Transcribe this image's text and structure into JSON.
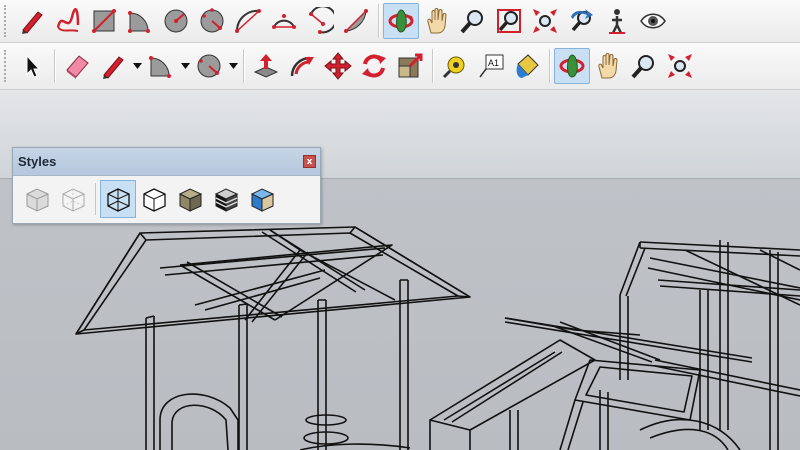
{
  "toolbar_row1": {
    "buttons": [
      {
        "name": "line-tool",
        "icon": "pencil-icon"
      },
      {
        "name": "freehand-tool",
        "icon": "freehand-curve-icon"
      },
      {
        "name": "rectangle-tool",
        "icon": "rectangle-icon"
      },
      {
        "name": "rotated-rectangle-tool",
        "icon": "rotated-rectangle-icon"
      },
      {
        "name": "circle-tool",
        "icon": "circle-icon"
      },
      {
        "name": "polygon-tool",
        "icon": "polygon-icon"
      },
      {
        "name": "arc-tool",
        "icon": "arc-icon"
      },
      {
        "name": "two-point-arc-tool",
        "icon": "two-point-arc-icon"
      },
      {
        "name": "three-point-arc-tool",
        "icon": "three-point-arc-icon"
      },
      {
        "name": "pie-tool",
        "icon": "pie-icon"
      },
      {
        "name": "orbit-tool",
        "icon": "orbit-icon",
        "active": true
      },
      {
        "name": "pan-tool",
        "icon": "hand-icon"
      },
      {
        "name": "zoom-tool",
        "icon": "magnifier-icon"
      },
      {
        "name": "zoom-window-tool",
        "icon": "zoom-window-icon"
      },
      {
        "name": "zoom-extents-tool",
        "icon": "zoom-extents-icon"
      },
      {
        "name": "previous-view-tool",
        "icon": "previous-view-icon"
      },
      {
        "name": "walk-tool",
        "icon": "walk-icon"
      },
      {
        "name": "look-around-tool",
        "icon": "eye-icon"
      }
    ]
  },
  "toolbar_row2": {
    "label_text_icon": "A1",
    "buttons": [
      {
        "name": "select-tool",
        "icon": "arrow-cursor-icon"
      },
      {
        "name": "eraser-tool",
        "icon": "eraser-icon"
      },
      {
        "name": "line-tool",
        "icon": "pencil-icon",
        "dropdown": true
      },
      {
        "name": "rectangle-tool",
        "icon": "rectangle-icon",
        "dropdown": true
      },
      {
        "name": "circle-tool",
        "icon": "circle-icon",
        "dropdown": true
      },
      {
        "name": "push-pull-tool",
        "icon": "push-pull-icon"
      },
      {
        "name": "follow-me-tool",
        "icon": "follow-me-icon"
      },
      {
        "name": "move-tool",
        "icon": "move-icon"
      },
      {
        "name": "rotate-tool",
        "icon": "rotate-icon"
      },
      {
        "name": "scale-tool",
        "icon": "scale-icon"
      },
      {
        "name": "tape-measure-tool",
        "icon": "tape-measure-icon"
      },
      {
        "name": "text-tool",
        "icon": "text-label-icon"
      },
      {
        "name": "paint-bucket-tool",
        "icon": "paint-bucket-icon"
      },
      {
        "name": "orbit-tool",
        "icon": "orbit-icon",
        "active": true
      },
      {
        "name": "pan-tool",
        "icon": "hand-icon"
      },
      {
        "name": "zoom-tool",
        "icon": "magnifier-icon"
      },
      {
        "name": "zoom-extents-tool",
        "icon": "zoom-extents-icon"
      }
    ]
  },
  "styles_panel": {
    "title": "Styles",
    "close_label": "x",
    "styles": [
      {
        "name": "xray-style",
        "icon": "xray-cube-icon"
      },
      {
        "name": "back-edges-style",
        "icon": "back-edges-cube-icon"
      },
      {
        "name": "wireframe-style",
        "icon": "wireframe-cube-icon",
        "active": true
      },
      {
        "name": "hidden-line-style",
        "icon": "hidden-line-cube-icon"
      },
      {
        "name": "shaded-style",
        "icon": "shaded-cube-icon"
      },
      {
        "name": "shaded-with-textures-style",
        "icon": "textured-cube-icon"
      },
      {
        "name": "monochrome-style",
        "icon": "monochrome-cube-icon"
      }
    ]
  },
  "colors": {
    "tool_red": "#d2202f",
    "active_highlight": "#c9dff3",
    "viewport_sky": "#dfe2e5",
    "viewport_ground": "#bcc0c5",
    "wire": "#111111"
  }
}
